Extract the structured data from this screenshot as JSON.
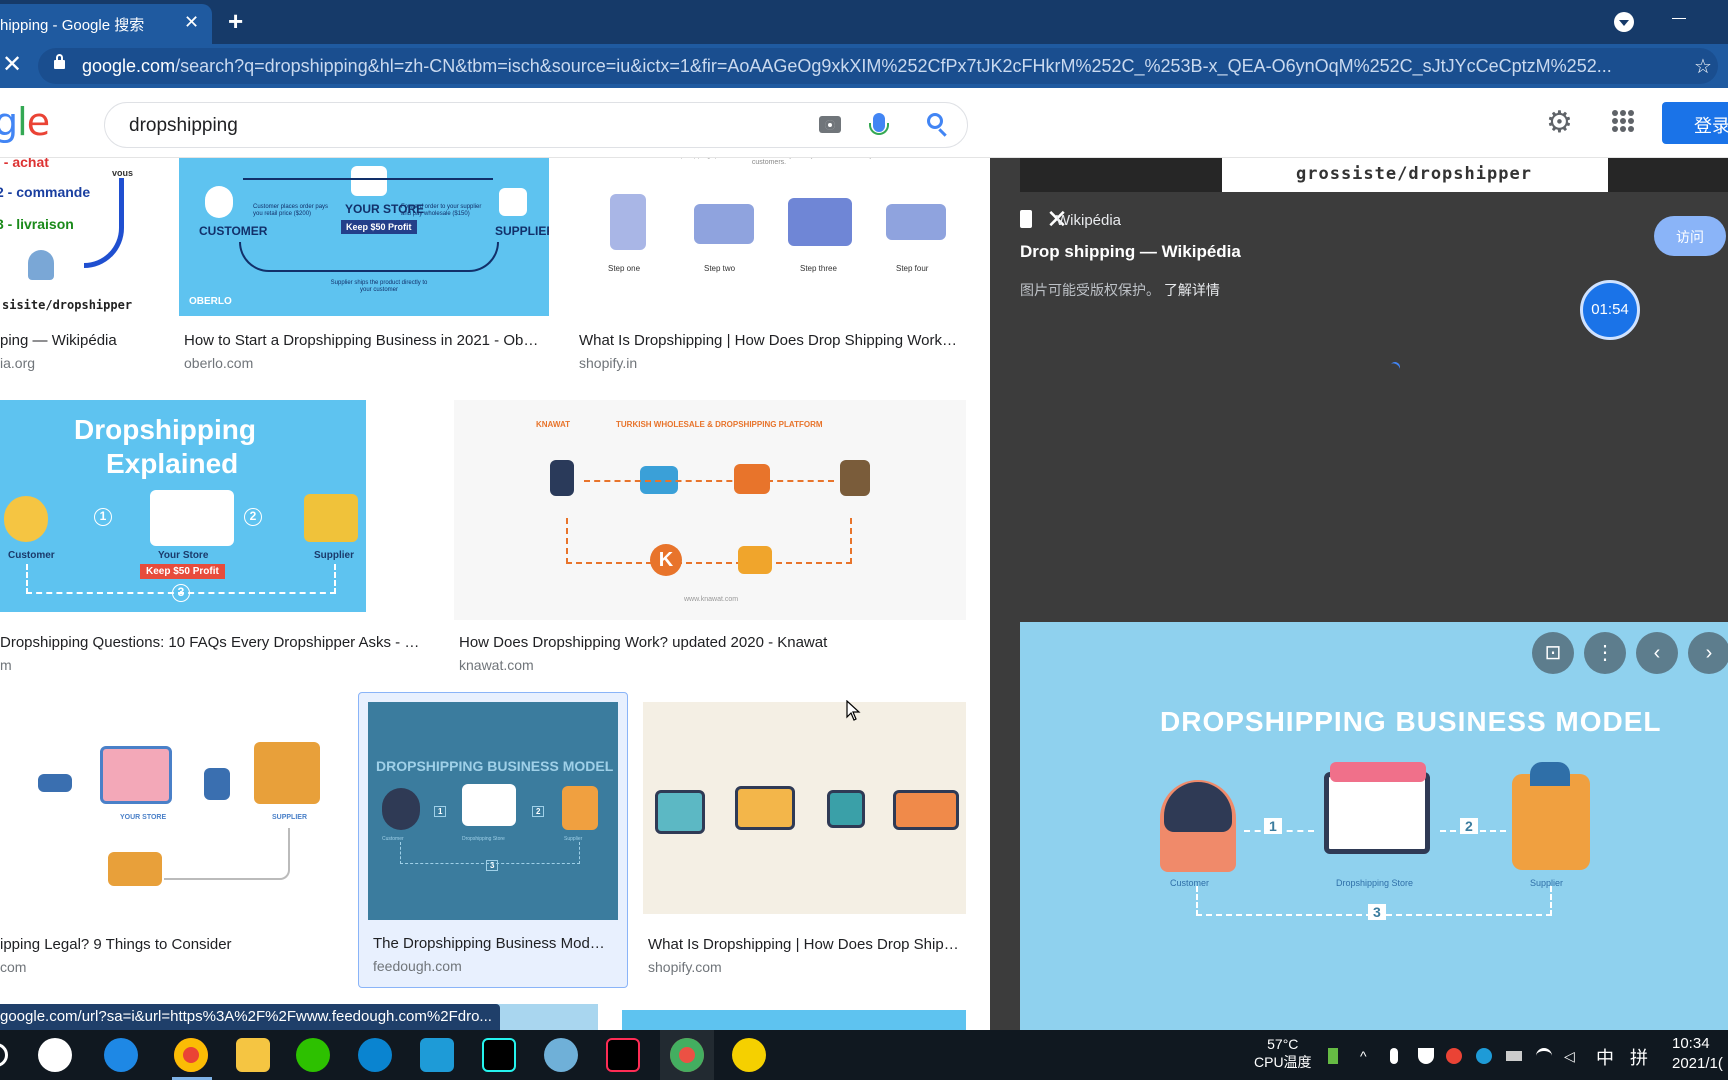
{
  "tab": {
    "title": "hipping - Google 搜索",
    "close": "✕",
    "new": "+"
  },
  "address": {
    "domain": "google.com",
    "path": "/search?q=dropshipping&hl=zh-CN&tbm=isch&source=iu&ictx=1&fir=AoAAGeOg9xkXIM%252CfPx7tJK2cFHkrM%252C_%253B-x_QEA-O6ynOqM%252C_sJtJYcCeCptzM%252..."
  },
  "google": {
    "logo": [
      "g",
      "l",
      "e"
    ],
    "query": "dropshipping",
    "signin": "登录"
  },
  "colors": {
    "accent": "#1a73e8",
    "chrome": "#1f5aa0",
    "panel": "#3c3c3c",
    "diagram_blue": "#5ec3f0"
  },
  "results": [
    {
      "title": "ping — Wikipédia",
      "source": "ia.org",
      "diagram": {
        "lines": [
          "I - achat",
          "2 - commande",
          "3 - livraison"
        ],
        "badge": "vous",
        "footer": "sisite/dropshipper"
      }
    },
    {
      "title": "How to Start a Dropshipping Business in 2021 - Ob…",
      "source": "oberlo.com",
      "diagram": {
        "left": "CUSTOMER",
        "center": "YOUR STORE",
        "right": "SUPPLIER",
        "profit": "Keep $50 Profit",
        "brand": "OBERLO",
        "step1": "Customer places order pays you retail price ($200)",
        "step2": "Forward order to your supplier and pay wholesale ($150)",
        "step3": "Supplier ships the product directly to your customer"
      }
    },
    {
      "title": "What Is Dropshipping | How Does Drop Shipping Work…",
      "source": "shopify.in",
      "diagram": {
        "header": "With dropshipping, products are sent directly from your wholesaler to your customers.",
        "steps": [
          "Step one",
          "Step two",
          "Step three",
          "Step four"
        ]
      }
    },
    {
      "title": "Dropshipping Questions: 10 FAQs Every Dropshipper Asks - …",
      "source": "m",
      "diagram": {
        "title1": "Dropshipping",
        "title2": "Explained",
        "left": "Customer",
        "center": "Your Store",
        "right": "Supplier",
        "profit": "Keep $50 Profit",
        "n1": "1",
        "n2": "2",
        "n3": "3"
      }
    },
    {
      "title": "How Does Dropshipping Work? updated 2020 - Knawat",
      "source": "knawat.com",
      "diagram": {
        "brand": "KNAWAT",
        "header": "TURKISH WHOLESALE & DROPSHIPPING PLATFORM",
        "footer": "www.knawat.com",
        "logo": "K"
      }
    },
    {
      "title": "ipping Legal? 9 Things to Consider",
      "source": "com",
      "diagram": {
        "store": "YOUR STORE",
        "supplier": "SUPPLIER"
      }
    },
    {
      "title": "The Dropshipping Business Mod…",
      "source": "feedough.com",
      "diagram": {
        "title": "DROPSHIPPING BUSINESS MODEL",
        "n1": "1",
        "n2": "2",
        "n3": "3",
        "labels": [
          "Customer",
          "Dropshipping Store",
          "Supplier"
        ]
      }
    },
    {
      "title": "What Is Dropshipping | How Does Drop Ship…",
      "source": "shopify.com"
    }
  ],
  "panel": {
    "top_image_text": "grossiste/dropshipper",
    "site": "Wikipédia",
    "title": "Drop shipping — Wikipédia",
    "note": "图片可能受版权保护。",
    "learn_more": "了解详情",
    "visit": "访问",
    "timer": "01:54",
    "close": "✕",
    "image": {
      "title": "DROPSHIPPING BUSINESS MODEL",
      "n1": "1",
      "n2": "2",
      "n3": "3",
      "labels": [
        "Customer",
        "Dropshipping Store",
        "Supplier"
      ]
    }
  },
  "status_url": "google.com/url?sa=i&url=https%3A%2F%2Fwww.feedough.com%2Fdro...",
  "taskbar": {
    "temp": "57°C",
    "temp_label": "CPU温度",
    "ime1": "中",
    "ime2": "拼",
    "time": "10:34",
    "date": "2021/1("
  }
}
